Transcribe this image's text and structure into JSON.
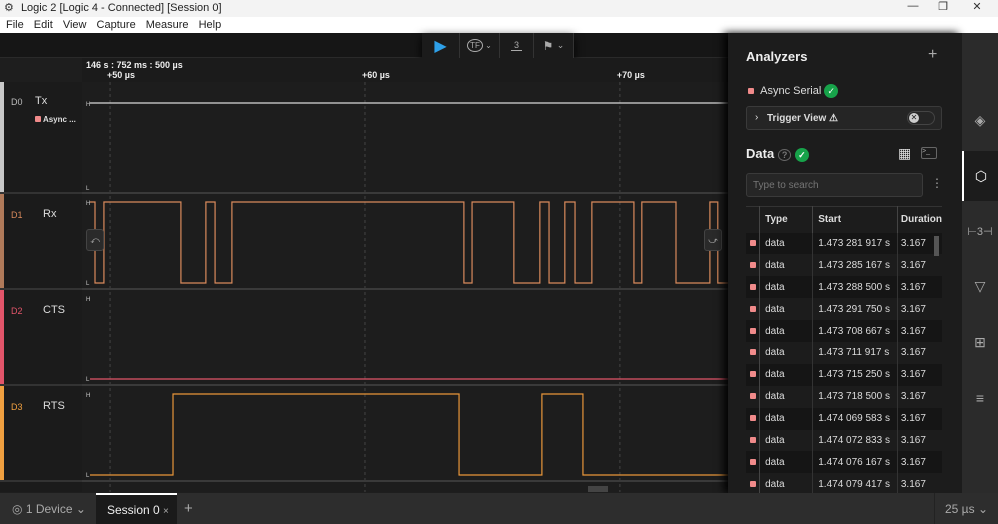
{
  "window": {
    "title": "Logic 2 [Logic 4 - Connected] [Session 0]",
    "min": "—",
    "max": "❐",
    "close": "✕"
  },
  "menu": [
    "File",
    "Edit",
    "View",
    "Capture",
    "Measure",
    "Help"
  ],
  "toolbar": {
    "play": "▶",
    "trigger": "TF",
    "measure": "3",
    "markers": "⚑"
  },
  "ruler": {
    "origin": "146 s : 752 ms : 500 µs",
    "ticks": [
      {
        "label": "+50 µs",
        "t": 50
      },
      {
        "label": "+60 µs",
        "t": 60
      },
      {
        "label": "+70 µs",
        "t": 70
      }
    ]
  },
  "view_range_us": [
    48.9,
    74.24
  ],
  "channels": [
    {
      "id": "D0",
      "name": "Tx",
      "color": "#c8c8c8",
      "analyzer": "Async ...",
      "initial": 1,
      "edges": [],
      "wave": "#d8d8d8"
    },
    {
      "id": "D1",
      "name": "Rx",
      "color": "#b07a5a",
      "initial": 1,
      "edges": [
        49.41,
        49.76,
        52.78,
        53.76,
        54.12,
        54.78,
        63.88,
        64.2,
        65.84,
        66.86,
        67.22,
        67.84,
        68.24,
        68.9,
        70.55,
        70.86,
        72.2,
        73.53,
        73.84
      ],
      "wave": "#d98a5c"
    },
    {
      "id": "D2",
      "name": "CTS",
      "color": "#e2556a",
      "initial": 0,
      "edges": [],
      "wave": "#e2556a"
    },
    {
      "id": "D3",
      "name": "RTS",
      "color": "#f0a040",
      "initial": 0,
      "edges": [
        52.47,
        63.69,
        66.94,
        68.55
      ],
      "wave": "#e8963a"
    }
  ],
  "analyzers": {
    "title": "Analyzers",
    "add": "+",
    "items": [
      {
        "name": "Async Serial",
        "color": "#f08a8a"
      }
    ],
    "trigger_view": "Trigger View ⚠"
  },
  "data": {
    "title": "Data",
    "search_placeholder": "Type to search",
    "columns": [
      "Type",
      "Start",
      "Duration"
    ],
    "rows": [
      [
        "data",
        "1.473 281 917 s",
        "3.167"
      ],
      [
        "data",
        "1.473 285 167 s",
        "3.167"
      ],
      [
        "data",
        "1.473 288 500 s",
        "3.167"
      ],
      [
        "data",
        "1.473 291 750 s",
        "3.167"
      ],
      [
        "data",
        "1.473 708 667 s",
        "3.167"
      ],
      [
        "data",
        "1.473 711 917 s",
        "3.167"
      ],
      [
        "data",
        "1.473 715 250 s",
        "3.167"
      ],
      [
        "data",
        "1.473 718 500 s",
        "3.167"
      ],
      [
        "data",
        "1.474 069 583 s",
        "3.167"
      ],
      [
        "data",
        "1.474 072 833 s",
        "3.167"
      ],
      [
        "data",
        "1.474 076 167 s",
        "3.167"
      ],
      [
        "data",
        "1.474 079 417 s",
        "3.167"
      ]
    ]
  },
  "bottom": {
    "device": "1 Device",
    "session": "Session 0",
    "close": "×",
    "add": "+",
    "timescale": "25 µs"
  }
}
